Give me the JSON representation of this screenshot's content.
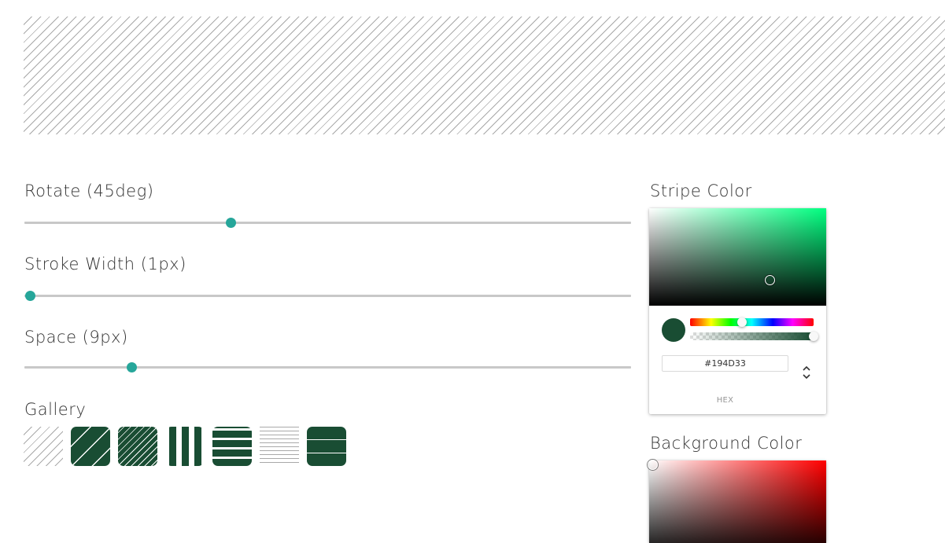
{
  "preview": {
    "stripe_color": "#a9a9a9",
    "background_color": "#ffffff"
  },
  "controls": {
    "rotate": {
      "label": "Rotate (45deg)",
      "value": 45,
      "fraction": 0.337
    },
    "stroke_width": {
      "label": "Stroke Width (1px)",
      "value": 1,
      "fraction": 0.0
    },
    "space": {
      "label": "Space (9px)",
      "value": 9,
      "fraction": 0.17
    }
  },
  "gallery": {
    "label": "Gallery",
    "items": [
      {
        "name": "gallery-item-thin-diagonal",
        "bg": "#ffffff",
        "stripe": "#a9a9a9"
      },
      {
        "name": "gallery-item-wide-diagonal",
        "bg": "#194d33",
        "stripe": "#ffffff"
      },
      {
        "name": "gallery-item-dense-diagonal",
        "bg": "#194d33",
        "stripe": "#ffffff"
      },
      {
        "name": "gallery-item-vertical",
        "bg": "#ffffff",
        "stripe": "#194d33"
      },
      {
        "name": "gallery-item-horizontal-thick",
        "bg": "#ffffff",
        "stripe": "#194d33"
      },
      {
        "name": "gallery-item-horizontal-thin",
        "bg": "#ffffff",
        "stripe": "#a9a9a9"
      },
      {
        "name": "gallery-item-horizontal-lines",
        "bg": "#194d33",
        "stripe": "#ffffff"
      }
    ]
  },
  "stripe_color": {
    "label": "Stripe Color",
    "hex": "#194D33",
    "hue_color": "#00ff80",
    "hue_fraction": 0.42,
    "alpha_fraction": 1.0,
    "format_label": "HEX"
  },
  "background_color": {
    "label": "Background Color",
    "hue_color": "#ff0000"
  }
}
